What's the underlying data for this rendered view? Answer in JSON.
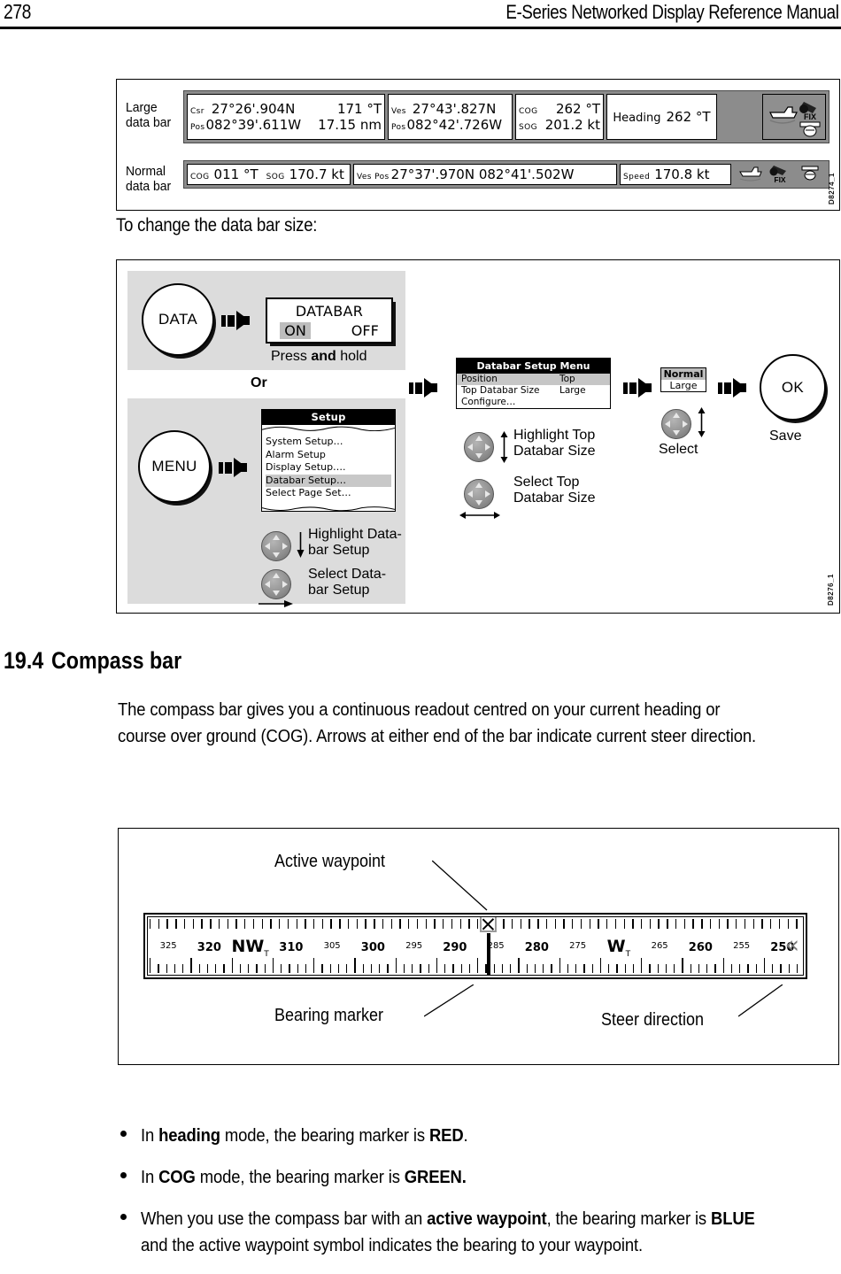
{
  "header": {
    "page_number": "278",
    "manual_title": "E-Series Networked Display Reference Manual"
  },
  "databar_figure": {
    "figure_code": "D8274_1",
    "large_label_line1": "Large",
    "large_label_line2": "data bar",
    "normal_label_line1": "Normal",
    "normal_label_line2": "data bar",
    "large_cells": [
      {
        "r1_tag": "Csr",
        "r1_val": "27°26'.904N",
        "r1_extra": "171 °T",
        "r2_tag": "Pos",
        "r2_val": "082°39'.611W",
        "r2_extra": "17.15 nm"
      },
      {
        "r1_tag": "Ves",
        "r1_val": "27°43'.827N",
        "r1_extra": "",
        "r2_tag": "Pos",
        "r2_val": "082°42'.726W",
        "r2_extra": ""
      },
      {
        "r1_tag": "COG",
        "r1_val": "262 °T",
        "r1_extra": "",
        "r2_tag": "SOG",
        "r2_val": "201.2 kt",
        "r2_extra": ""
      },
      {
        "r1_tag": "Heading",
        "r1_val": "262 °T",
        "r1_extra": "",
        "r2_tag": "",
        "r2_val": "",
        "r2_extra": ""
      }
    ],
    "normal_cells": [
      {
        "tag1": "COG",
        "val1": "011 °T",
        "tag2": "SOG",
        "val2": "170.7 kt"
      },
      {
        "tag1": "Ves Pos",
        "val1": "27°37'.970N  082°41'.502W",
        "tag2": "",
        "val2": ""
      },
      {
        "tag1": "Speed",
        "val1": "170.8 kt",
        "tag2": "",
        "val2": ""
      }
    ],
    "status_icons": {
      "fix_label": "FIX"
    }
  },
  "caption": "To change the data bar size:",
  "flow_figure": {
    "figure_code": "D8276_1",
    "data_key": "DATA",
    "menu_key": "MENU",
    "ok_key": "OK",
    "ok_caption": "Save",
    "databar_popup": {
      "title": "DATABAR",
      "option_on": "ON",
      "option_off": "OFF"
    },
    "press_and_hold": {
      "pre": "Press ",
      "bold": "and",
      "post": " hold"
    },
    "or_label": "Or",
    "setup_menu": {
      "title": "Setup",
      "items": [
        {
          "label": "System Setup…",
          "selected": false
        },
        {
          "label": "Alarm Setup",
          "selected": false
        },
        {
          "label": "Display Setup….",
          "selected": false
        },
        {
          "label": "Databar Setup…",
          "selected": true
        },
        {
          "label": "Select Page Set…",
          "selected": false
        }
      ]
    },
    "menu_actions": [
      {
        "text": "Highlight Data-\nbar Setup",
        "direction": "vertical"
      },
      {
        "text": "Select Data-\nbar Setup",
        "direction": "right"
      }
    ],
    "databar_setup_menu": {
      "title": "Databar Setup Menu",
      "rows": [
        {
          "label": "Position",
          "value": "Top",
          "selected": true
        },
        {
          "label": "Top Databar Size",
          "value": "Large",
          "selected": false
        },
        {
          "label": "Configure…",
          "value": "",
          "selected": false
        }
      ]
    },
    "setup_actions": [
      {
        "text": "Highlight Top\nDatabar Size",
        "direction": "vertical"
      },
      {
        "text": "Select Top\nDatabar  Size",
        "direction": "horizontal"
      }
    ],
    "size_selector": {
      "option_selected": "Normal",
      "option_other": "Large",
      "caption": "Select"
    }
  },
  "section": {
    "number": "19.4",
    "title": "Compass bar",
    "paragraph": "The compass bar gives you a continuous readout centred on your current heading or course over ground (COG). Arrows at either end of the bar indicate current steer direction."
  },
  "compass_figure": {
    "annotations": {
      "active_waypoint": "Active waypoint",
      "bearing_marker": "Bearing marker",
      "steer_direction": "Steer direction"
    },
    "scale_labels": [
      {
        "text": "325",
        "style": "minor"
      },
      {
        "text": "320",
        "style": "major"
      },
      {
        "text": "NW",
        "style": "card",
        "sub": "T"
      },
      {
        "text": "310",
        "style": "major"
      },
      {
        "text": "305",
        "style": "minor"
      },
      {
        "text": "300",
        "style": "major"
      },
      {
        "text": "295",
        "style": "minor"
      },
      {
        "text": "290",
        "style": "major"
      },
      {
        "text": "285",
        "style": "minor"
      },
      {
        "text": "280",
        "style": "major"
      },
      {
        "text": "275",
        "style": "minor"
      },
      {
        "text": "W",
        "style": "card",
        "sub": "T"
      },
      {
        "text": "265",
        "style": "minor"
      },
      {
        "text": "260",
        "style": "major"
      },
      {
        "text": "255",
        "style": "minor"
      },
      {
        "text": "250",
        "style": "major"
      }
    ],
    "bearing_marker_value": "286",
    "waypoint_marker_value": "286",
    "steer_arrow": "«"
  },
  "bullets": [
    {
      "segments": [
        {
          "t": "In ",
          "b": false
        },
        {
          "t": "heading",
          "b": true
        },
        {
          "t": " mode, the bearing marker is ",
          "b": false
        },
        {
          "t": "RED",
          "b": true
        },
        {
          "t": ".",
          "b": false
        }
      ]
    },
    {
      "segments": [
        {
          "t": "In ",
          "b": false
        },
        {
          "t": "COG",
          "b": true
        },
        {
          "t": " mode, the bearing marker is ",
          "b": false
        },
        {
          "t": "GREEN.",
          "b": true
        }
      ]
    },
    {
      "segments": [
        {
          "t": "When you use the compass bar with an ",
          "b": false
        },
        {
          "t": "active waypoint",
          "b": true
        },
        {
          "t": ", the bearing marker is ",
          "b": false
        },
        {
          "t": "BLUE",
          "b": true
        },
        {
          "t": " and the active waypoint symbol indicates the bearing to your waypoint.",
          "b": false
        }
      ]
    }
  ]
}
